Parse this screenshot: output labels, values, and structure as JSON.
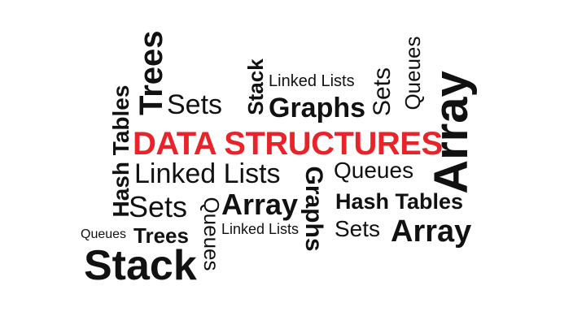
{
  "title_color": "#e8232a",
  "text_color": "#111111",
  "words": {
    "data_structures": "DATA STRUCTURES",
    "hash_tables_vertical": "Hash Tables",
    "trees_vertical": "Trees",
    "sets_top": "Sets",
    "stack_vertical": "Stack",
    "linked_lists_top": "Linked Lists",
    "graphs_top": "Graphs",
    "sets_vertical": "Sets",
    "queues_vertical_top": "Queues",
    "array_vertical": "Array",
    "linked_lists_mid": "Linked Lists",
    "queues_right": "Queues",
    "graphs_vertical": "Graphs",
    "sets_mid": "Sets",
    "queues_vertical_mid": "Queues",
    "array_mid": "Array",
    "hash_tables_right": "Hash Tables",
    "linked_lists_small": "Linked Lists",
    "sets_right": "Sets",
    "array_right": "Array",
    "queues_small": "Queues",
    "trees_small": "Trees",
    "stack_big": "Stack"
  }
}
